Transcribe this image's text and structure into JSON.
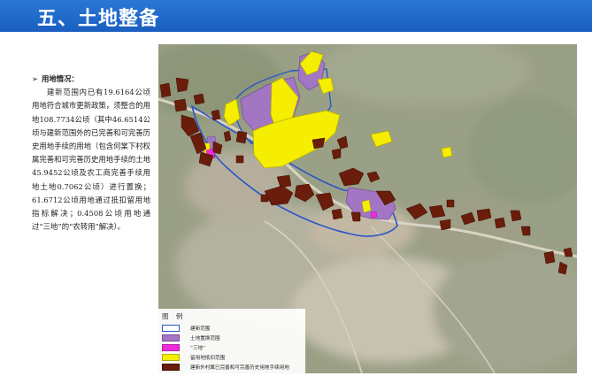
{
  "page": {
    "title": "五、土地整备"
  },
  "section": {
    "bullet": "➢",
    "heading": "用地情况：",
    "body": "建新范围内已有19.6164公顷用地符合城市更新政策，须整合的用地108.7734公顷（其中46.6514公顷与建新范围外的已完善和可完善历史用地手续的用地（包含何棠下村权属完善和可完善历史用地手续的土地45.9452公顷及农工商完善手续用地土地0.7062公顷）进行置换；61.6712公顷用地通过抵扣留用地指标解决；0.4508公顷用地通过“三地”的“农转用”解决）。"
  },
  "legend": {
    "title": "图 例",
    "items": [
      {
        "label": "建新范围",
        "color": "#ffffff",
        "border": "#2b56c9"
      },
      {
        "label": "土地置换范围",
        "color": "#a276c2",
        "border": "#7b4fa0"
      },
      {
        "label": "“三地”",
        "color": "#ee2cdb",
        "border": "#b31fa6"
      },
      {
        "label": "留用地抵扣范围",
        "color": "#f6ee00",
        "border": "#b8ae00"
      },
      {
        "label": "建新外村属已完善和可完善历史用地手续用地",
        "color": "#6a1d0a",
        "border": "#3f0f04"
      }
    ]
  },
  "colors": {
    "header": "#1f66cc",
    "brown": "#6a1d0a",
    "purple": "#a276c2",
    "yellow": "#f6ee00",
    "magenta": "#ee2cdb",
    "boundary": "#2b56c9"
  }
}
